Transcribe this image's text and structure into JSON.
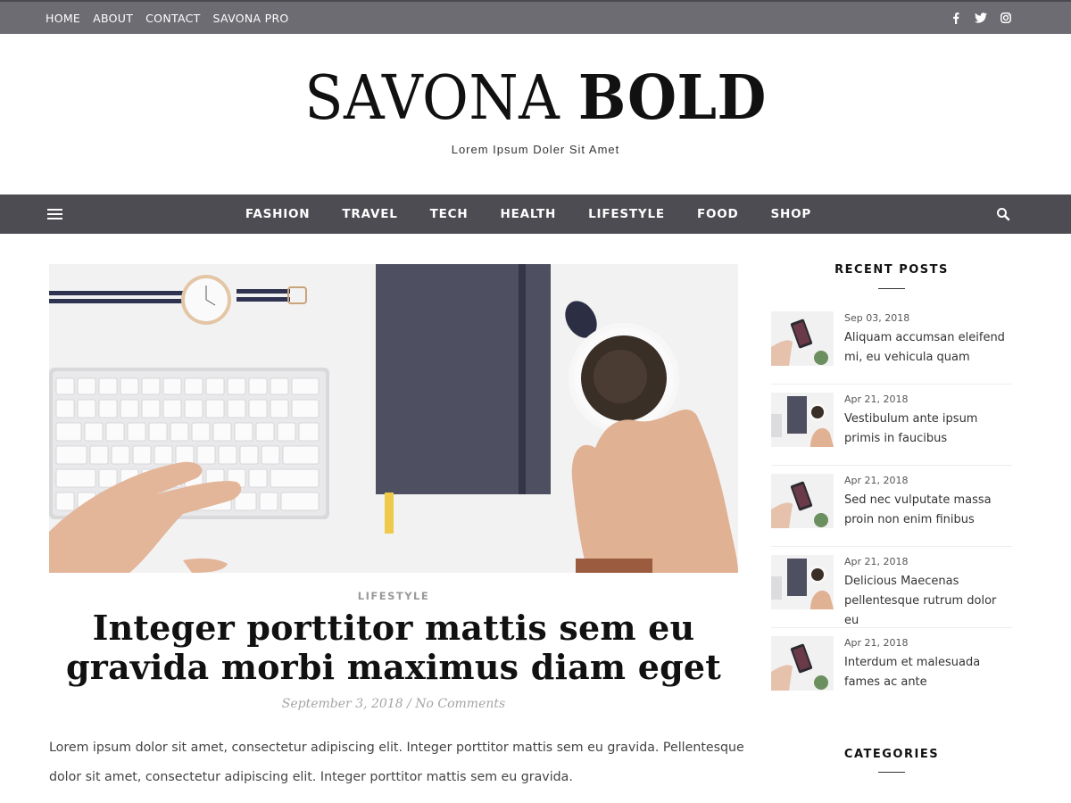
{
  "topbar": {
    "links": [
      "HOME",
      "ABOUT",
      "CONTACT",
      "SAVONA PRO"
    ],
    "social_icons": [
      "facebook-icon",
      "twitter-icon",
      "instagram-icon"
    ],
    "background": "#6c6c72"
  },
  "header": {
    "logo_thin": "SAVONA",
    "logo_bold": "BOLD",
    "tagline": "Lorem Ipsum Doler Sit Amet"
  },
  "nav": {
    "items": [
      "FASHION",
      "TRAVEL",
      "TECH",
      "HEALTH",
      "LIFESTYLE",
      "FOOD",
      "SHOP"
    ],
    "background": "#4c4c52"
  },
  "post": {
    "category": "LIFESTYLE",
    "title": "Integer porttitor mattis sem eu gravida morbi maximus diam eget",
    "date": "September 3, 2018",
    "separator": " / ",
    "comments": "No Comments",
    "excerpt": "Lorem ipsum dolor sit amet, consectetur adipiscing elit. Integer porttitor mattis sem eu gravida. Pellentesque dolor sit amet, consectetur adipiscing elit. Integer porttitor mattis sem eu gravida."
  },
  "sidebar": {
    "recent_title": "RECENT POSTS",
    "categories_title": "CATEGORIES",
    "recent_posts": [
      {
        "date": "Sep 03, 2018",
        "title": "Aliquam accumsan eleifend mi, eu vehicula quam",
        "thumb": "phone"
      },
      {
        "date": "Apr 21, 2018",
        "title": "Vestibulum ante ipsum primis in faucibus",
        "thumb": "notebook"
      },
      {
        "date": "Apr 21, 2018",
        "title": "Sed nec vulputate massa proin non enim finibus",
        "thumb": "phone"
      },
      {
        "date": "Apr 21, 2018",
        "title": "Delicious Maecenas pellentesque rutrum dolor eu",
        "thumb": "notebook"
      },
      {
        "date": "Apr 21, 2018",
        "title": "Interdum et malesuada fames ac ante",
        "thumb": "phone"
      }
    ]
  }
}
